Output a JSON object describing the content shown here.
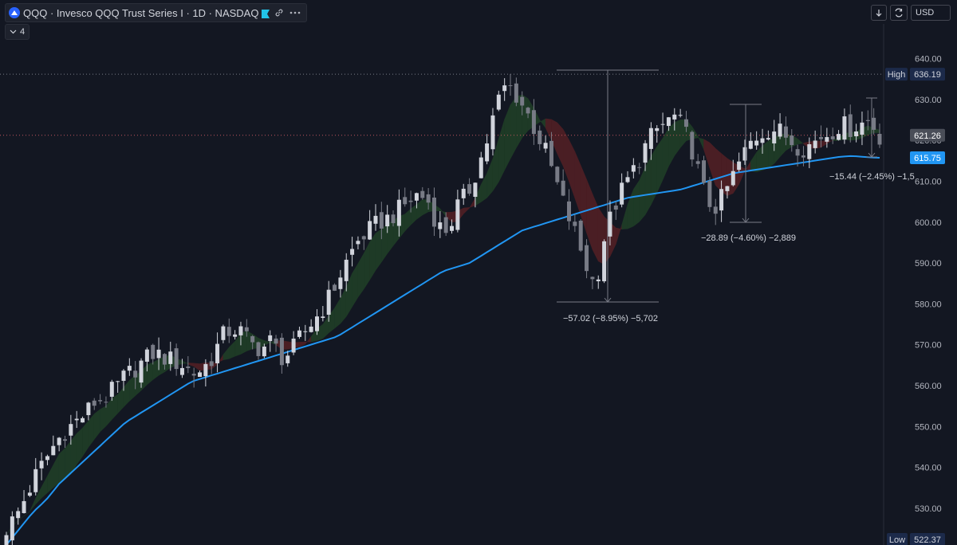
{
  "header": {
    "symbol_line": "QQQ · Invesco QQQ Trust Series I · 1D · NASDAQ",
    "indicator_count": "4",
    "currency": "USD"
  },
  "colors": {
    "background": "#131722",
    "candle": "#d1d4dc",
    "ma_line": "#2196f3",
    "cloud_bull": "#1e3a26",
    "cloud_bear": "#4a1e24",
    "accent_blue": "#2962ff"
  },
  "price_axis": {
    "ticks": [
      "640.00",
      "630.00",
      "620.00",
      "610.00",
      "600.00",
      "590.00",
      "580.00",
      "570.00",
      "560.00",
      "550.00",
      "540.00",
      "530.00"
    ],
    "labels": {
      "high_tag": "High",
      "high_value": "636.19",
      "last_value": "621.26",
      "ma_value": "615.75",
      "low_tag": "Low",
      "low_value": "522.37"
    }
  },
  "measurements": [
    {
      "text": "−57.02 (−8.95%) −5,702"
    },
    {
      "text": "−28.89 (−4.60%) −2,889"
    },
    {
      "text": "−15.44 (−2.45%) −1,5"
    }
  ],
  "chart_data": {
    "type": "candlestick",
    "timeframe": "1D",
    "ylim": [
      521,
      645
    ],
    "y_ticks": [
      530,
      540,
      550,
      560,
      570,
      580,
      590,
      600,
      610,
      620,
      630,
      640
    ],
    "high": 636.19,
    "last": 621.26,
    "low": 522.37,
    "ma_last": 615.75,
    "close_path": [
      525,
      528,
      533,
      538,
      542,
      546,
      549,
      551,
      553,
      556,
      557,
      559,
      562,
      564,
      566,
      568,
      567,
      566,
      565,
      563,
      564,
      567,
      572,
      574,
      573,
      570,
      569,
      571,
      567,
      568,
      572,
      575,
      578,
      582,
      587,
      592,
      596,
      598,
      600,
      601,
      603,
      605,
      607,
      605,
      599,
      598,
      604,
      607,
      613,
      620,
      629,
      634,
      631,
      627,
      622,
      617,
      610,
      603,
      597,
      590,
      584,
      597,
      604,
      609,
      613,
      618,
      622,
      624,
      626,
      623,
      617,
      608,
      603,
      606,
      611,
      616,
      620,
      622,
      623,
      622,
      620,
      618,
      619,
      621,
      622,
      624,
      623,
      624,
      625,
      621
    ],
    "ma_path": [
      521,
      525,
      529,
      532,
      536,
      539,
      542,
      545,
      548,
      551,
      553,
      555,
      557,
      559,
      561,
      562,
      563,
      564,
      565,
      566,
      567,
      568,
      569,
      570,
      571,
      572,
      574,
      576,
      578,
      580,
      582,
      584,
      586,
      588,
      589,
      590,
      592,
      594,
      596,
      598,
      599,
      600,
      601,
      602,
      603,
      604,
      605,
      606,
      606.5,
      607,
      607.5,
      608,
      609,
      610,
      611,
      612,
      612.5,
      613,
      613.5,
      614,
      614.5,
      615,
      615.5,
      616,
      616.2,
      615.9,
      615.75
    ]
  }
}
